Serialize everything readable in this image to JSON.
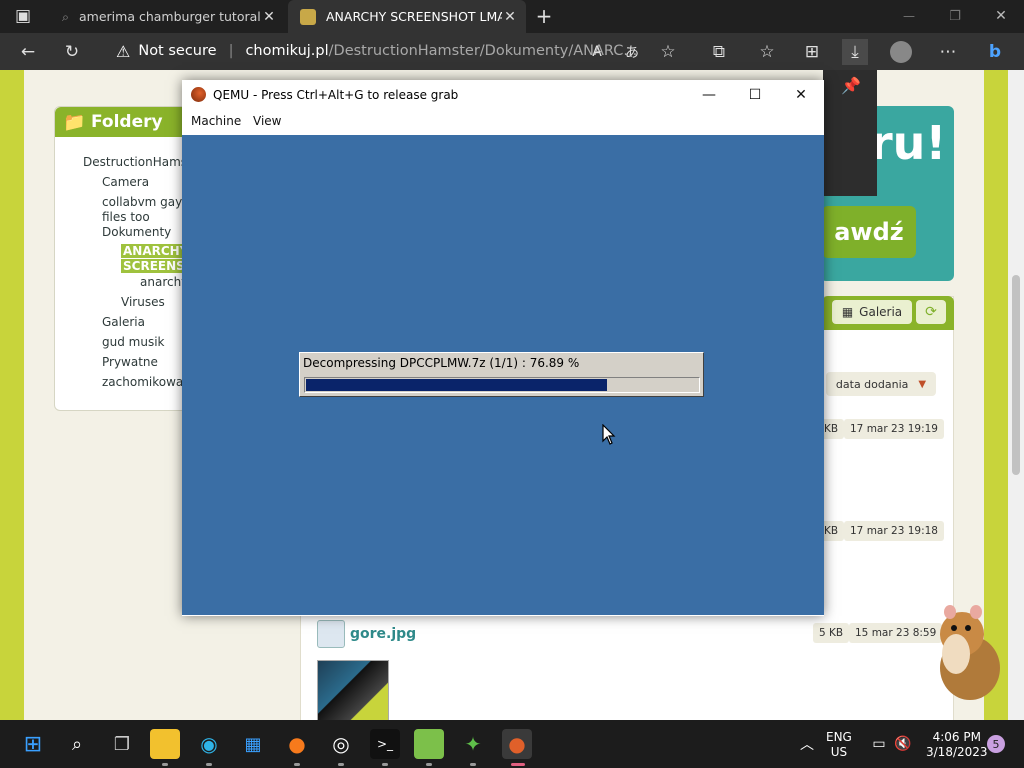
{
  "browser": {
    "tabs": [
      {
        "title": "amerima chamburger tutoral - Se",
        "close": "✕"
      },
      {
        "title": "ANARCHY SCREENSHOT LMAO",
        "close": "✕"
      }
    ],
    "new_tab": "+",
    "address": {
      "security": "Not secure",
      "domain": "chomikuj.pl",
      "path": "/DestructionHamster/Dokumenty/ANARC..."
    },
    "window_controls": {
      "minimize": "—",
      "restore": "❐",
      "close": "✕"
    }
  },
  "page": {
    "sidebar": {
      "title": "Foldery",
      "items": [
        {
          "label": "DestructionHams"
        },
        {
          "label": "Camera"
        },
        {
          "label": "collabvm gay"
        },
        {
          "label": "files too"
        },
        {
          "label": "Dokumenty"
        },
        {
          "label": "ANARCHY"
        },
        {
          "label": "SCREENSH"
        },
        {
          "label": "anarchy"
        },
        {
          "label": "Viruses"
        },
        {
          "label": "Galeria"
        },
        {
          "label": "gud musik"
        },
        {
          "label": "Prywatne"
        },
        {
          "label": "zachomikowan"
        }
      ]
    },
    "banner": {
      "big": "ru!",
      "button": "awdź"
    },
    "galeria_label": "Galeria",
    "sort_label": "data dodania",
    "files": [
      {
        "size": "KB",
        "date": "17 mar 23 19:19"
      },
      {
        "size": "KB",
        "date": "17 mar 23 19:18"
      },
      {
        "size": "5 KB",
        "date": "15 mar 23 8:59"
      }
    ],
    "file_name": "gore.jpg"
  },
  "qemu": {
    "title": "QEMU - Press Ctrl+Alt+G to release grab",
    "menu": [
      "Machine",
      "View"
    ],
    "dialog": {
      "text": "Decompressing DPCCPLMW.7z  (1/1) : 76.89 %",
      "progress": 0.7689
    }
  },
  "taskbar": {
    "lang": "ENG",
    "region": "US",
    "time": "4:06 PM",
    "date": "3/18/2023",
    "notifications": "5"
  },
  "colors": {
    "page_bg": "#c8d43b",
    "qemu_screen": "#3a6ea5",
    "progress_fill": "#0a246a",
    "accent_green": "#8ab32a"
  }
}
